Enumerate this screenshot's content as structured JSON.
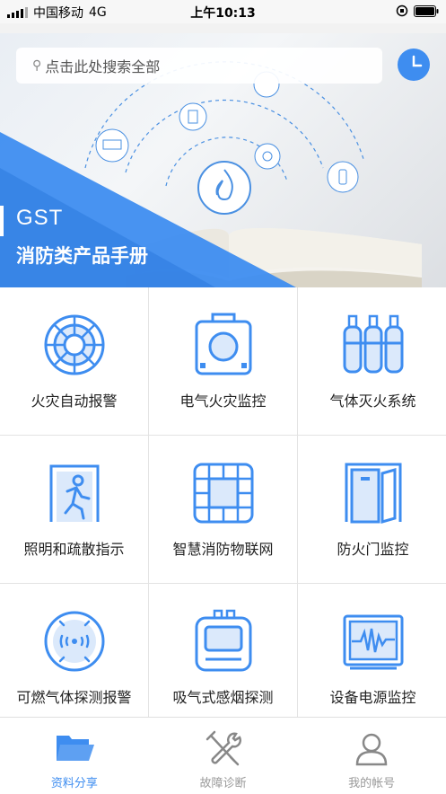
{
  "status_bar": {
    "carrier": "中国移动",
    "network": "4G",
    "time": "上午10:13"
  },
  "banner": {
    "search_placeholder": "点击此处搜索全部",
    "brand": "GST",
    "subtitle": "消防类产品手册"
  },
  "categories": [
    {
      "label": "火灾自动报警",
      "icon": "fire-alarm-detector-icon"
    },
    {
      "label": "电气火灾监控",
      "icon": "electrical-monitor-icon"
    },
    {
      "label": "气体灭火系统",
      "icon": "gas-cylinders-icon"
    },
    {
      "label": "照明和疏散指示",
      "icon": "evacuation-exit-icon"
    },
    {
      "label": "智慧消防物联网",
      "icon": "iot-grid-icon"
    },
    {
      "label": "防火门监控",
      "icon": "fire-door-icon"
    },
    {
      "label": "可燃气体探测报警",
      "icon": "gas-detector-icon"
    },
    {
      "label": "吸气式感烟探测",
      "icon": "aspirating-smoke-detector-icon"
    },
    {
      "label": "设备电源监控",
      "icon": "power-monitor-icon"
    }
  ],
  "tabs": [
    {
      "label": "资料分享",
      "active": true,
      "icon": "folder-icon"
    },
    {
      "label": "故障诊断",
      "active": false,
      "icon": "tools-icon"
    },
    {
      "label": "我的帐号",
      "active": false,
      "icon": "user-icon"
    }
  ],
  "colors": {
    "accent": "#3e8df0",
    "tab_inactive": "#999999"
  }
}
